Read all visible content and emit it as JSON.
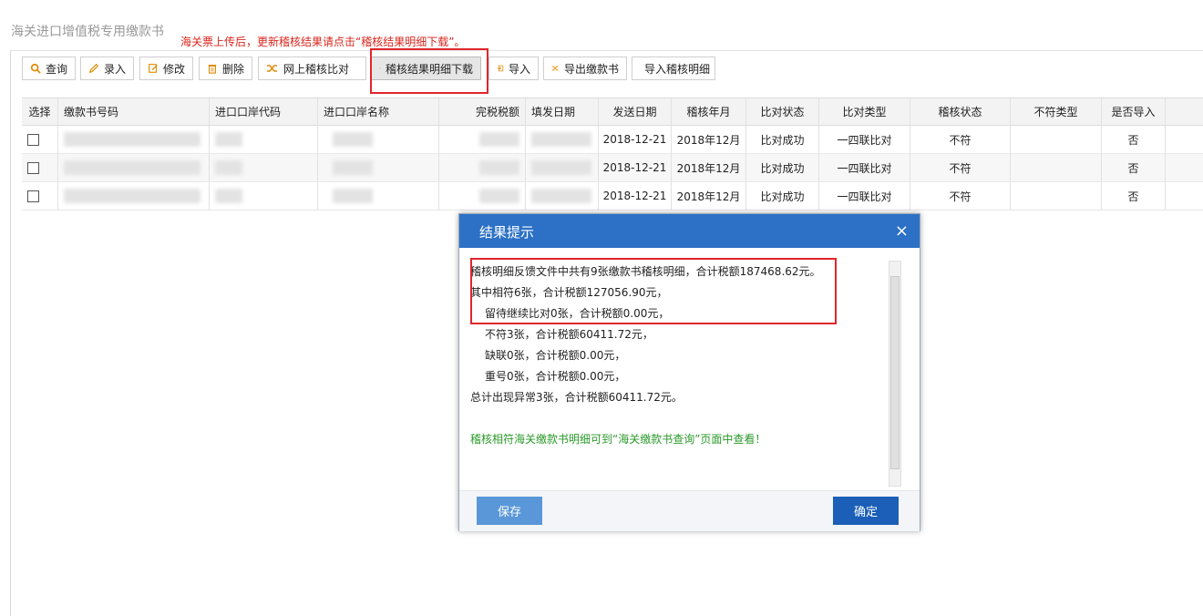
{
  "page": {
    "title": "海关进口增值税专用缴款书",
    "notice": "海关票上传后，更新稽核结果请点击“稽核结果明细下载”。"
  },
  "toolbar": {
    "query": "查询",
    "entry": "录入",
    "modify": "修改",
    "delete": "删除",
    "online_compare": "网上稽核比对",
    "download_detail": "稽核结果明细下载",
    "import": "导入",
    "export_payment": "导出缴款书",
    "import_detail": "导入稽核明细"
  },
  "table": {
    "headers": [
      "选择",
      "缴款书号码",
      "进口口岸代码",
      "进口口岸名称",
      "完税税额",
      "填发日期",
      "发送日期",
      "稽核年月",
      "比对状态",
      "比对类型",
      "稽核状态",
      "不符类型",
      "是否导入"
    ],
    "rows": [
      {
        "send_date": "2018-12-21",
        "audit_month": "2018年12月",
        "compare_status": "比对成功",
        "compare_type": "一四联比对",
        "audit_status": "不符",
        "mismatch_type": "",
        "imported": "否"
      },
      {
        "send_date": "2018-12-21",
        "audit_month": "2018年12月",
        "compare_status": "比对成功",
        "compare_type": "一四联比对",
        "audit_status": "不符",
        "mismatch_type": "",
        "imported": "否"
      },
      {
        "send_date": "2018-12-21",
        "audit_month": "2018年12月",
        "compare_status": "比对成功",
        "compare_type": "一四联比对",
        "audit_status": "不符",
        "mismatch_type": "",
        "imported": "否"
      }
    ]
  },
  "dialog": {
    "title": "结果提示",
    "close": "×",
    "lines": [
      "稽核明细反馈文件中共有9张缴款书稽核明细，合计税额187468.62元。",
      "其中相符6张，合计税额127056.90元，",
      "留待继续比对0张，合计税额0.00元，",
      "不符3张，合计税额60411.72元，",
      "缺联0张，合计税额0.00元，",
      "重号0张，合计税额0.00元，",
      "总计出现异常3张，合计税额60411.72元。"
    ],
    "tip": "稽核相符海关缴款书明细可到“海关缴款书查询”页面中查看！",
    "save": "保存",
    "ok": "确定"
  },
  "colors": {
    "accent": "#2c71c6",
    "highlight": "#e0262b",
    "notice": "#d9261c",
    "tip": "#2a9a2a"
  }
}
